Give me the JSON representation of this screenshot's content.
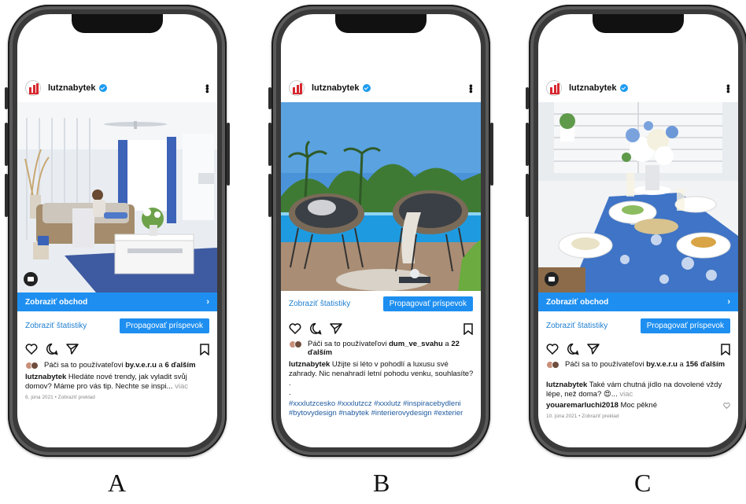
{
  "colors": {
    "accent": "#1e8ff0",
    "link": "#1e7fd0",
    "logo": "#d7282f"
  },
  "panels": [
    {
      "letter": "A",
      "account": "lutznabytek",
      "shop_label": "Zobraziť obchod",
      "stats_label": "Zobraziť štatistiky",
      "promote_label": "Propagovať príspevok",
      "likes_prefix": "Páči sa to používateľovi",
      "likes_user": "by.v.e.r.u",
      "likes_mid": "a",
      "likes_others": "6 ďalším",
      "caption_text": "Hledáte nové trendy, jak vyladit svůj domov? Máme pro vás tip. Nechte se inspi...",
      "more_label": "viac",
      "date": "6. júna 2021 • Zobraziť preklad"
    },
    {
      "letter": "B",
      "account": "lutznabytek",
      "stats_label": "Zobraziť štatistiky",
      "promote_label": "Propagovať príspevok",
      "likes_prefix": "Páči sa to používateľovi",
      "likes_user": "dum_ve_svahu",
      "likes_mid": "a",
      "likes_others": "22 ďalším",
      "caption_text": "Užijte si léto v pohodlí a luxusu své zahrady. Nic nenahradí letní pohodu venku, souhlasíte?",
      "dot1": ".",
      "dot2": ".",
      "hashtags": "#xxxlutzcesko #xxxlutzcz #xxxlutz #inspiracebydleni #bytovydesign #nabytek #interierovydesign #exterier"
    },
    {
      "letter": "C",
      "account": "lutznabytek",
      "shop_label": "Zobraziť obchod",
      "stats_label": "Zobraziť štatistiky",
      "promote_label": "Propagovať príspevok",
      "likes_prefix": "Páči sa to používateľovi",
      "likes_user": "by.v.e.r.u",
      "likes_mid": "a",
      "likes_others": "156 ďalším",
      "caption_text": "Také vám chutná jídlo na dovolené vždy lépe, než doma? 😍...",
      "more_label": "viac",
      "comment_user": "youaremarluchi2018",
      "comment_text": "Moc pěkné",
      "date": "10. júna 2021 • Zobraziť preklad"
    }
  ]
}
